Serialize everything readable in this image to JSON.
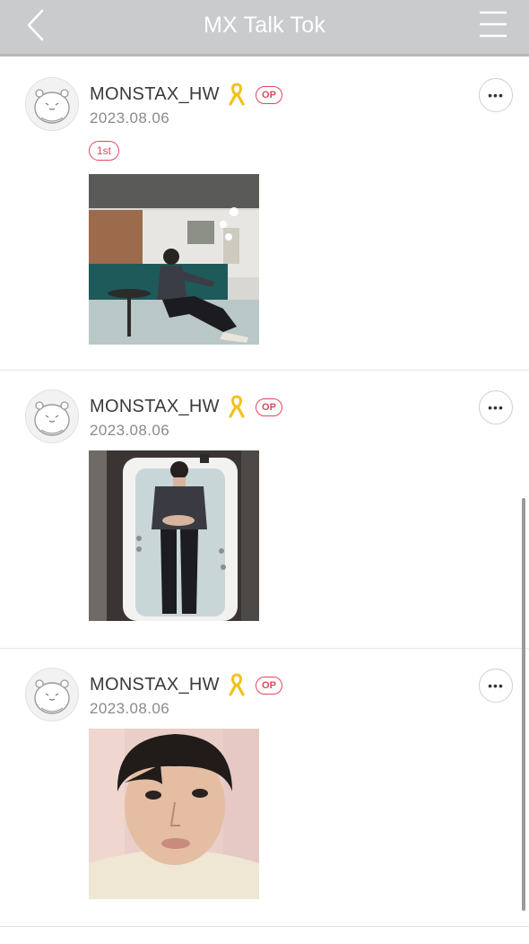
{
  "header": {
    "title": "MX Talk Tok",
    "back_icon": "chevron-left-icon",
    "menu_icon": "hamburger-menu-icon"
  },
  "posts": [
    {
      "username": "MONSTAX_HW",
      "ribbon_icon": "yellow-ribbon-icon",
      "op_label": "OP",
      "date": "2023.08.06",
      "rank_label": "1st",
      "more_icon": "more-options-icon"
    },
    {
      "username": "MONSTAX_HW",
      "ribbon_icon": "yellow-ribbon-icon",
      "op_label": "OP",
      "date": "2023.08.06",
      "more_icon": "more-options-icon"
    },
    {
      "username": "MONSTAX_HW",
      "ribbon_icon": "yellow-ribbon-icon",
      "op_label": "OP",
      "date": "2023.08.06",
      "more_icon": "more-options-icon"
    }
  ],
  "colors": {
    "header_bg": "#c9cbcd",
    "accent_red": "#e0475c",
    "ribbon_yellow": "#f2c21b"
  }
}
